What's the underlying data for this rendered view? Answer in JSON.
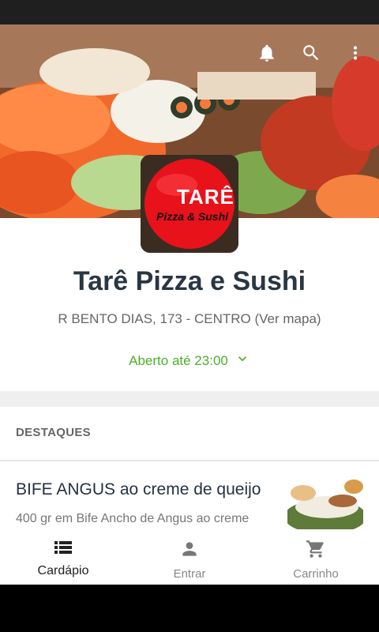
{
  "header": {
    "icons": [
      "bell-icon",
      "search-icon",
      "more-vert-icon"
    ]
  },
  "restaurant": {
    "logo_title": "TARÊ",
    "logo_subtitle": "Pizza & Sushi",
    "name": "Tarê Pizza e Sushi",
    "address": "R BENTO DIAS, 173 - CENTRO (Ver mapa)",
    "open_status": "Aberto até 23:00"
  },
  "highlights": {
    "header": "DESTAQUES",
    "items": [
      {
        "title": "BIFE ANGUS ao creme de queijo",
        "description": "400 gr em Bife Ancho de Angus ao creme"
      }
    ]
  },
  "bottom_nav": {
    "items": [
      {
        "label": "Cardápio",
        "icon": "menu-list-icon",
        "active": true
      },
      {
        "label": "Entrar",
        "icon": "person-icon",
        "active": false
      },
      {
        "label": "Carrinho",
        "icon": "cart-icon",
        "active": false
      }
    ]
  },
  "colors": {
    "accent_green": "#4caf29",
    "title_color": "#2a3642",
    "logo_red": "#e8121b"
  }
}
